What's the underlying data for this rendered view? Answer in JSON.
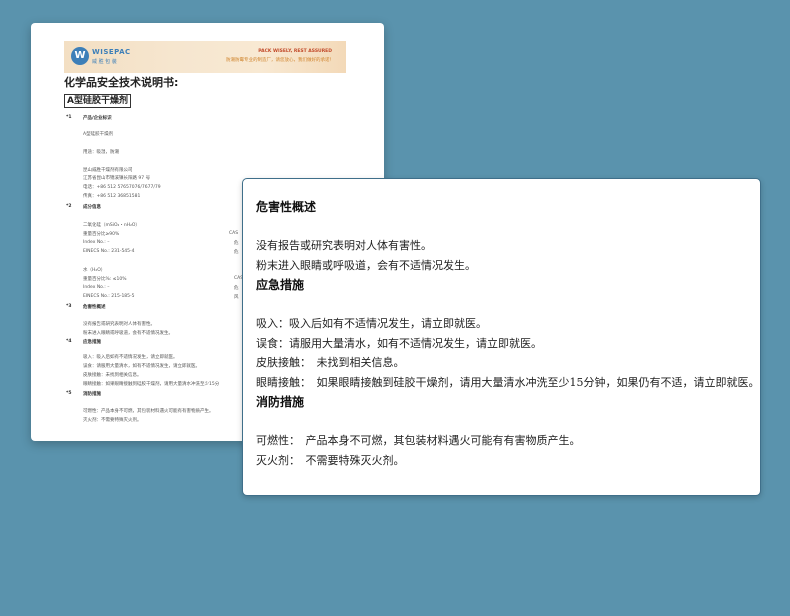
{
  "back_doc": {
    "logo_mark": "W",
    "logo_name": "WISEPAC",
    "logo_sub": "威 胜 包 装",
    "banner_line1": "PACK WISELY, REST ASSURED",
    "banner_line2": "防潮防霉专业的制造厂，请您放心，我们做好的承诺！",
    "title": "化学品安全技术说明书:",
    "product": "A型硅胶干燥剂",
    "sections": [
      {
        "num": "*1",
        "title": "产品/企业标识",
        "lines": [
          "A型硅胶干燥剂",
          "用途：吸湿，防潮",
          "昆山威胜干燥剂有限公司",
          "江苏省昆山市锦溪镇长阳路 97 号",
          "电话：+86 512 57657076/7677/79",
          "传真：+86 512 36851581"
        ]
      },
      {
        "num": "*2",
        "title": "成分信息",
        "lines": [
          "二氧化硅（mSiO₂・nH₂O）",
          "重量百分比≥90%",
          "Index No.: –",
          "EINECS No.: 231-545-4",
          "水（H₂O）",
          "重量百分比%: ≤10%",
          "Index No.: –",
          "EINECS No.: 215-185-5"
        ]
      },
      {
        "num": "*3",
        "title": "危害性概述",
        "lines": [
          "没有报告或研究表明对人体有害性。",
          "粉末进入眼睛或呼吸道，会有不适情况发生。"
        ]
      },
      {
        "num": "*4",
        "title": "应急措施",
        "lines": [
          "吸入：吸入后如有不适情况发生，请立即就医。",
          "误食：请服用大量清水，如有不适情况发生，请立即就医。",
          "皮肤接触：未找到相关信息。",
          "眼睛接触：如果眼睛接触到硅胶干燥剂，请用大量清水冲洗至少15分"
        ]
      },
      {
        "num": "*5",
        "title": "消防措施",
        "lines": [
          "可燃性：产品本身不可燃，其包装材料遇火可能有有害物质产生。",
          "灭火剂：不需要特殊灭火剂。"
        ]
      }
    ],
    "right_col": [
      "CAS",
      "危",
      "危",
      "CAS",
      "危",
      "风"
    ]
  },
  "card": {
    "hazard_heading": "危害性概述",
    "hazard_lines": [
      "没有报告或研究表明对人体有害性。",
      "粉末进入眼睛或呼吸道，会有不适情况发生。"
    ],
    "firstaid_heading": "应急措施",
    "firstaid_lines": [
      "吸入：吸入后如有不适情况发生，请立即就医。",
      "误食：请服用大量清水，如有不适情况发生，请立即就医。",
      "皮肤接触：　未找到相关信息。",
      "眼睛接触：　如果眼睛接触到硅胶干燥剂，请用大量清水冲洗至少15分钟，如果仍有不适，请立即就医。"
    ],
    "fire_heading": "消防措施",
    "fire_lines": [
      "可燃性：　产品本身不可燃，其包装材料遇火可能有有害物质产生。",
      "灭火剂：　不需要特殊灭火剂。"
    ]
  }
}
